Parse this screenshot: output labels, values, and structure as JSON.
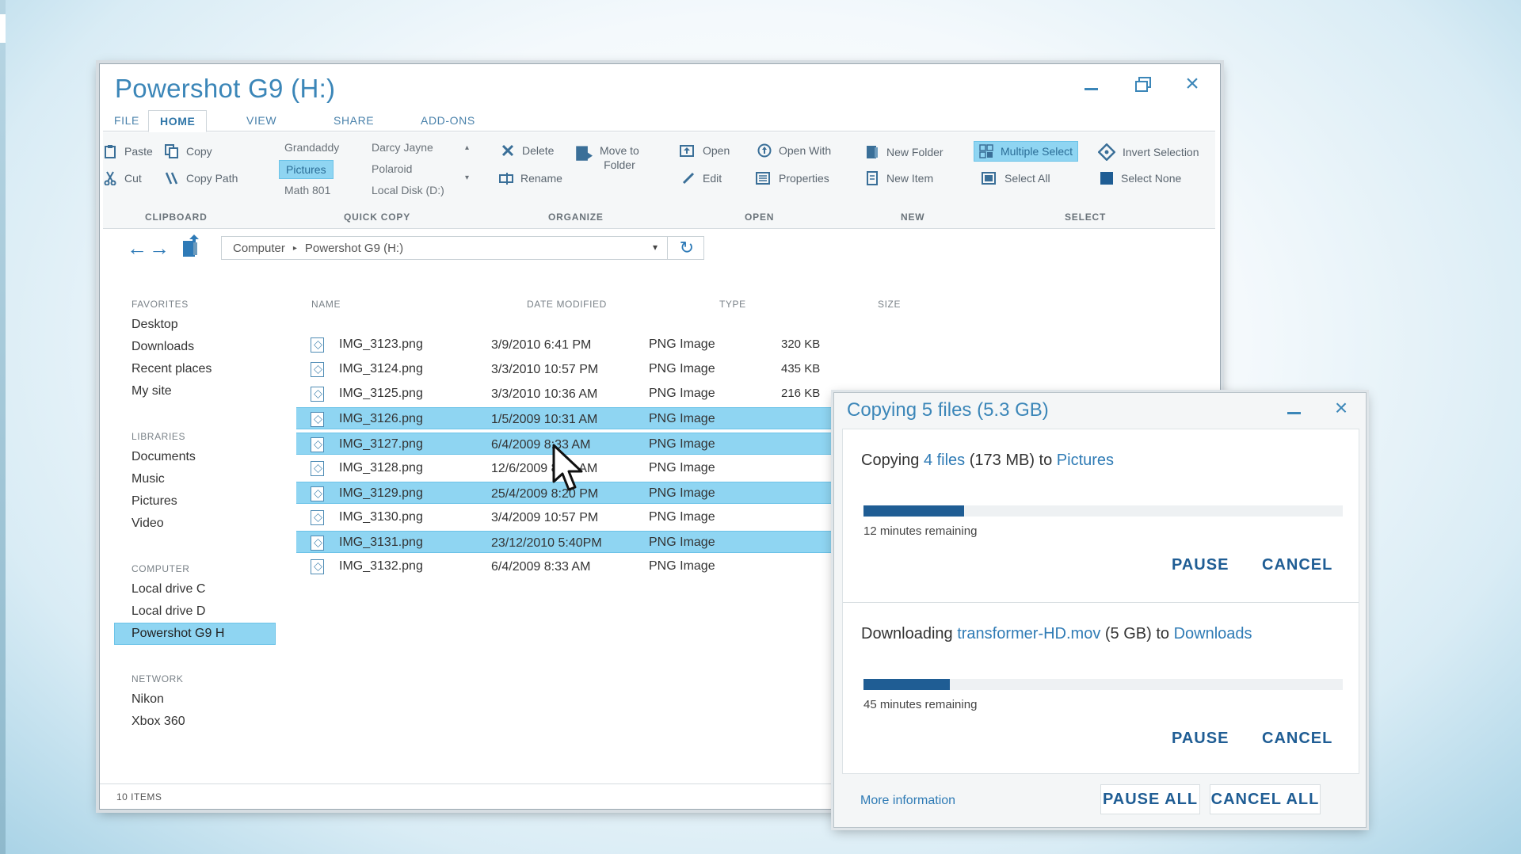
{
  "window": {
    "title": "Powershot G9 (H:)"
  },
  "tabs": [
    "FILE",
    "HOME",
    "VIEW",
    "SHARE",
    "ADD-ONS"
  ],
  "ribbon": {
    "clipboard": {
      "group": "CLIPBOARD",
      "paste": "Paste",
      "copy": "Copy",
      "cut": "Cut",
      "copy_path": "Copy Path"
    },
    "quick_copy": {
      "group": "QUICK COPY",
      "col1": [
        "Grandaddy",
        "Pictures",
        "Math 801"
      ],
      "col2": [
        "Darcy Jayne",
        "Polaroid",
        "Local Disk (D:)"
      ],
      "selected": "Pictures"
    },
    "organize": {
      "group": "ORGANIZE",
      "delete": "Delete",
      "move_to_folder_1": "Move to",
      "move_to_folder_2": "Folder",
      "rename": "Rename"
    },
    "open": {
      "group": "OPEN",
      "open": "Open",
      "open_with": "Open With",
      "edit": "Edit",
      "properties": "Properties"
    },
    "new": {
      "group": "NEW",
      "new_folder": "New Folder",
      "new_item": "New Item"
    },
    "select": {
      "group": "SELECT",
      "multiple_select": "Multiple Select",
      "invert_selection": "Invert Selection",
      "select_all": "Select All",
      "select_none": "Select None"
    }
  },
  "address": {
    "crumbs": [
      "Computer",
      "Powershot G9 (H:)"
    ]
  },
  "sidebar": {
    "favorites": {
      "heading": "FAVORITES",
      "items": [
        "Desktop",
        "Downloads",
        "Recent places",
        "My site"
      ]
    },
    "libraries": {
      "heading": "LIBRARIES",
      "items": [
        "Documents",
        "Music",
        "Pictures",
        "Video"
      ]
    },
    "computer": {
      "heading": "COMPUTER",
      "items": [
        "Local drive C",
        "Local drive D",
        "Powershot G9 H"
      ]
    },
    "network": {
      "heading": "NETWORK",
      "items": [
        "Nikon",
        "Xbox 360"
      ]
    }
  },
  "columns": {
    "name": "NAME",
    "date": "DATE MODIFIED",
    "type": "TYPE",
    "size": "SIZE"
  },
  "files": [
    {
      "name": "IMG_3123.png",
      "date": "3/9/2010 6:41 PM",
      "type": "PNG Image",
      "size": "320 KB",
      "selected": false
    },
    {
      "name": "IMG_3124.png",
      "date": "3/3/2010 10:57 PM",
      "type": "PNG Image",
      "size": "435 KB",
      "selected": false
    },
    {
      "name": "IMG_3125.png",
      "date": "3/3/2010 10:36 AM",
      "type": "PNG Image",
      "size": "216 KB",
      "selected": false
    },
    {
      "name": "IMG_3126.png",
      "date": "1/5/2009 10:31 AM",
      "type": "PNG Image",
      "size": "",
      "selected": true
    },
    {
      "name": "IMG_3127.png",
      "date": "6/4/2009 8:33 AM",
      "type": "PNG Image",
      "size": "",
      "selected": true
    },
    {
      "name": "IMG_3128.png",
      "date": "12/6/2009 8:50 AM",
      "type": "PNG Image",
      "size": "",
      "selected": false
    },
    {
      "name": "IMG_3129.png",
      "date": "25/4/2009 8:20 PM",
      "type": "PNG Image",
      "size": "",
      "selected": true
    },
    {
      "name": "IMG_3130.png",
      "date": "3/4/2009 10:57 PM",
      "type": "PNG Image",
      "size": "",
      "selected": false
    },
    {
      "name": "IMG_3131.png",
      "date": "23/12/2010 5:40PM",
      "type": "PNG Image",
      "size": "",
      "selected": true
    },
    {
      "name": "IMG_3132.png",
      "date": "6/4/2009 8:33 AM",
      "type": "PNG Image",
      "size": "",
      "selected": false
    }
  ],
  "status": {
    "count": "10 ITEMS"
  },
  "dialog": {
    "title": "Copying 5 files (5.3 GB)",
    "tasks": [
      {
        "prefix": "Copying ",
        "link1": "4 files",
        "middle": " (173 MB) to ",
        "link2": "Pictures",
        "progress": 0.21,
        "remaining": "12 minutes remaining",
        "pause": "PAUSE",
        "cancel": "CANCEL"
      },
      {
        "prefix": "Downloading ",
        "link1": "transformer-HD.mov",
        "middle": " (5 GB) to ",
        "link2": "Downloads",
        "progress": 0.18,
        "remaining": "45 minutes remaining",
        "pause": "PAUSE",
        "cancel": "CANCEL"
      }
    ],
    "more_info": "More information",
    "pause_all": "PAUSE ALL",
    "cancel_all": "CANCEL ALL"
  },
  "colors": {
    "accent": "#3b86b8",
    "selection": "#8fd5f2",
    "progress": "#1f5d94"
  },
  "icons": {
    "close": "×",
    "back": "←",
    "forward": "→",
    "refresh": "↻",
    "dropdown": "▾",
    "crumb_sep": "▸",
    "scroll_up": "▴",
    "scroll_down": "▾"
  }
}
